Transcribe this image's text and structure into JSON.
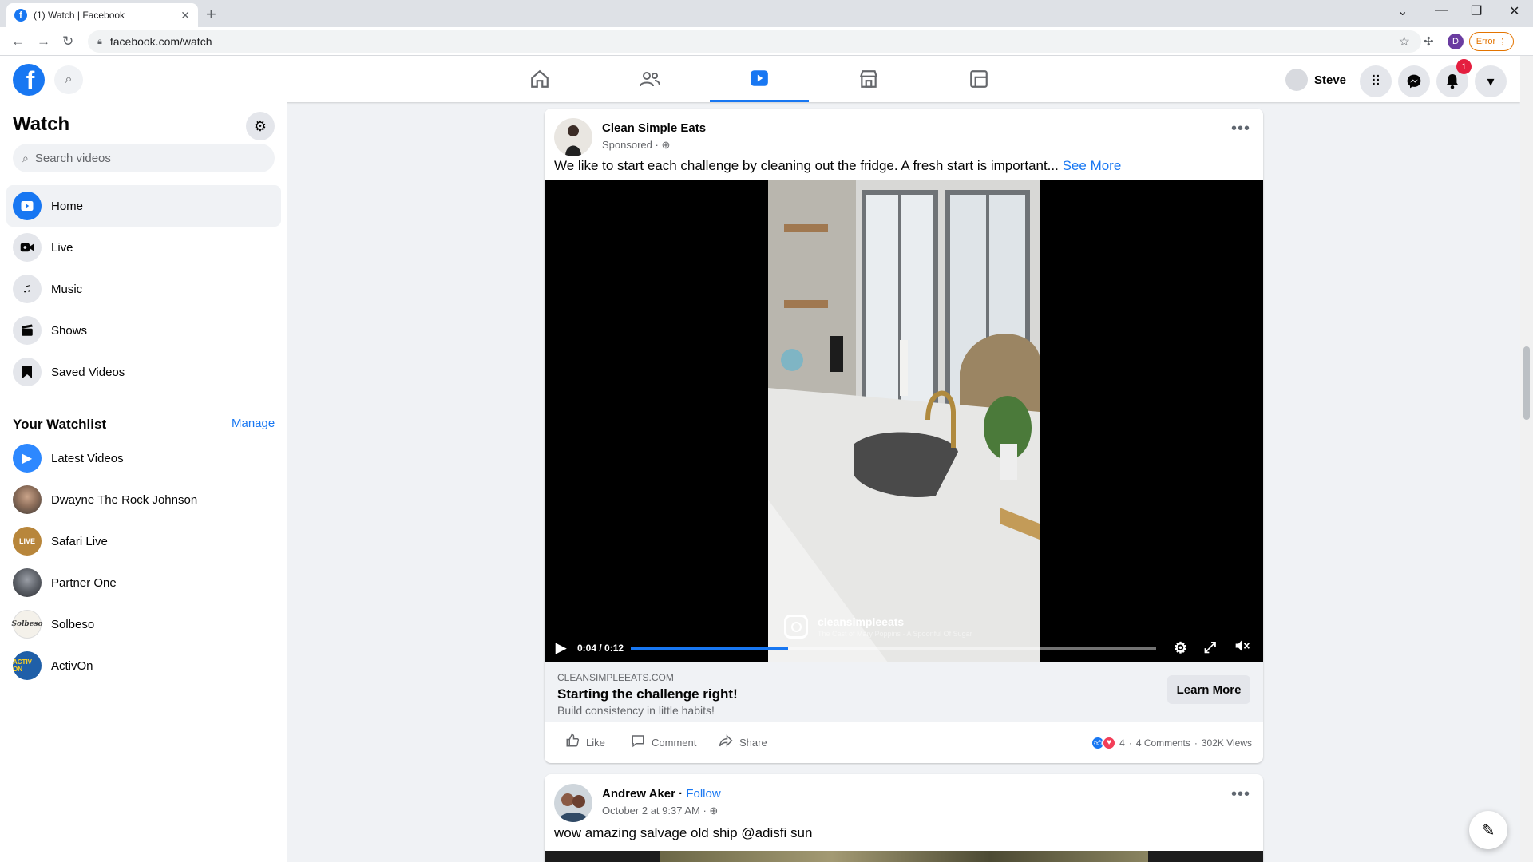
{
  "browser": {
    "tab_title": "(1) Watch | Facebook",
    "url": "facebook.com/watch",
    "profile_initial": "D",
    "error_label": "Error"
  },
  "header": {
    "user_name": "Steve",
    "notification_count": "1"
  },
  "sidebar": {
    "title": "Watch",
    "search_placeholder": "Search videos",
    "items": [
      {
        "label": "Home",
        "icon": "play-video-icon",
        "active": true
      },
      {
        "label": "Live",
        "icon": "live-camera-icon"
      },
      {
        "label": "Music",
        "icon": "music-note-icon"
      },
      {
        "label": "Shows",
        "icon": "clapperboard-icon"
      },
      {
        "label": "Saved Videos",
        "icon": "bookmark-icon"
      }
    ],
    "watchlist_title": "Your Watchlist",
    "manage_label": "Manage",
    "watchlist": [
      {
        "label": "Latest Videos"
      },
      {
        "label": "Dwayne The Rock Johnson"
      },
      {
        "label": "Safari Live"
      },
      {
        "label": "Partner One"
      },
      {
        "label": "Solbeso"
      },
      {
        "label": "ActivOn"
      }
    ]
  },
  "post1": {
    "author": "Clean Simple Eats",
    "meta": "Sponsored · ",
    "text": "We like to start each challenge by cleaning out the fridge. A fresh start is important... ",
    "see_more": "See More",
    "video": {
      "time": "0:04 / 0:12",
      "progress": 0.3,
      "watermark_handle": "cleansimpleeats",
      "watermark_song": "The Cast of Mary Poppins · A Spoonful Of Sugar"
    },
    "ad": {
      "domain": "CLEANSIMPLEEATS.COM",
      "headline": "Starting the challenge right!",
      "subtitle": "Build consistency in little habits!",
      "cta": "Learn More"
    },
    "actions": {
      "like": "Like",
      "comment": "Comment",
      "share": "Share"
    },
    "stats": {
      "reactions": "4",
      "comments": "4 Comments",
      "views": "302K Views"
    }
  },
  "post2": {
    "author": "Andrew Aker",
    "follow": "Follow",
    "meta": "October 2 at 9:37 AM · ",
    "text": "wow amazing salvage old ship @adisfi sun"
  },
  "colors": {
    "brand": "#1877f2",
    "background": "#f0f2f5"
  }
}
